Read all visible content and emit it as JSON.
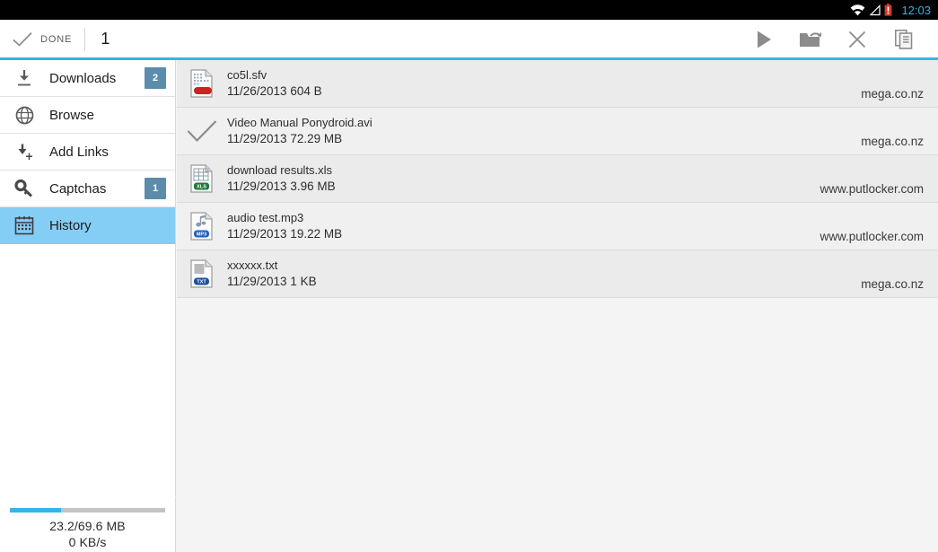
{
  "statusbar": {
    "time": "12:03",
    "icons": [
      "wifi-icon",
      "signal-icon",
      "battery-icon"
    ]
  },
  "actionbar": {
    "done_label": "DONE",
    "done_icon": "check-icon",
    "selection_count": "1",
    "actions": [
      {
        "name": "start-button",
        "icon": "play-icon"
      },
      {
        "name": "open-folder-button",
        "icon": "folder-arrow-icon"
      },
      {
        "name": "cancel-button",
        "icon": "close-icon"
      },
      {
        "name": "copy-button",
        "icon": "copy-icon"
      }
    ]
  },
  "sidebar": {
    "items": [
      {
        "label": "Downloads",
        "icon": "download-icon",
        "badge": "2",
        "active": false
      },
      {
        "label": "Browse",
        "icon": "globe-icon",
        "badge": "",
        "active": false
      },
      {
        "label": "Add Links",
        "icon": "add-link-icon",
        "badge": "",
        "active": false
      },
      {
        "label": "Captchas",
        "icon": "key-icon",
        "badge": "1",
        "active": false
      },
      {
        "label": "History",
        "icon": "history-calendar-icon",
        "badge": "",
        "active": true
      }
    ]
  },
  "footer": {
    "progress_percent": 33,
    "transferred": "23.2/69.6 MB",
    "speed": "0 KB/s"
  },
  "list": {
    "rows": [
      {
        "name": "co5l.sfv",
        "date": "11/26/2013",
        "size": "604 B",
        "meta": "11/26/2013  604 B",
        "host": "mega.co.nz",
        "icon": "file-sfv-icon",
        "badge_label": "",
        "badge_color": "#cc2222",
        "selected": false
      },
      {
        "name": "Video Manual Ponydroid.avi",
        "date": "11/29/2013",
        "size": "72.29 MB",
        "meta": "11/29/2013  72.29 MB",
        "host": "mega.co.nz",
        "icon": "check-icon",
        "badge_label": "",
        "badge_color": "",
        "selected": true
      },
      {
        "name": "download results.xls",
        "date": "11/29/2013",
        "size": "3.96 MB",
        "meta": "11/29/2013  3.96 MB",
        "host": "www.putlocker.com",
        "icon": "file-xls-icon",
        "badge_label": "XLS",
        "badge_color": "#1d7a3c",
        "selected": false
      },
      {
        "name": "audio test.mp3",
        "date": "11/29/2013",
        "size": "19.22 MB",
        "meta": "11/29/2013  19.22 MB",
        "host": "www.putlocker.com",
        "icon": "file-mp3-icon",
        "badge_label": "MP3",
        "badge_color": "#1f5fbf",
        "selected": false
      },
      {
        "name": "xxxxxx.txt",
        "date": "11/29/2013",
        "size": "1 KB",
        "meta": "11/29/2013  1 KB",
        "host": "mega.co.nz",
        "icon": "file-txt-icon",
        "badge_label": "TXT",
        "badge_color": "#1b4f9c",
        "selected": false
      }
    ]
  },
  "colors": {
    "accent": "#33b5e5",
    "selection": "#84cdf5",
    "badge": "#5b8cab"
  }
}
